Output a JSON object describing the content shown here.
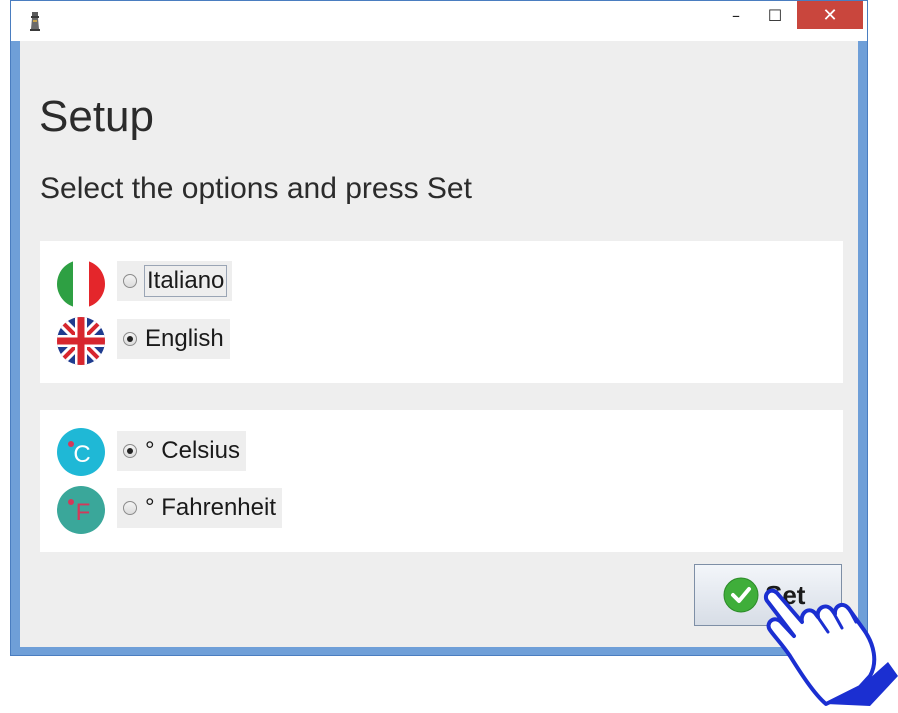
{
  "window": {
    "icon": "lighthouse-app-icon",
    "controls": {
      "minimize": "–",
      "maximize": "☐",
      "close": "✕"
    }
  },
  "header": {
    "title": "Setup",
    "subtitle": "Select the options and press Set"
  },
  "language": {
    "options": [
      {
        "label": "Italiano",
        "selected": false,
        "focused": true,
        "icon": "italy-flag-icon"
      },
      {
        "label": "English",
        "selected": true,
        "focused": false,
        "icon": "uk-flag-icon"
      }
    ]
  },
  "temperature": {
    "options": [
      {
        "label": "° Celsius",
        "selected": true,
        "icon": "celsius-icon",
        "icon_text": "C"
      },
      {
        "label": "° Fahrenheit",
        "selected": false,
        "icon": "fahrenheit-icon",
        "icon_text": "F"
      }
    ]
  },
  "actions": {
    "set_label": "Set"
  },
  "colors": {
    "accent_close": "#c9463d",
    "panel_bg": "#ffffff",
    "client_bg": "#eeeeee",
    "check_green": "#3fae3a",
    "hand_blue": "#1b2fd1"
  }
}
